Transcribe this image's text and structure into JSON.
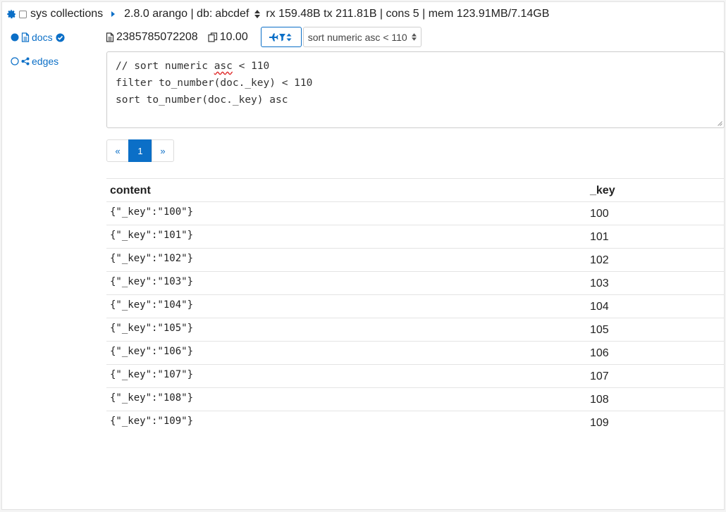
{
  "header": {
    "collections_label": "sys collections",
    "version_db_label": "2.8.0 arango | db:",
    "db_name": "abcdef",
    "stats": "rx 159.48B tx 211.81B | cons 5 | mem 123.91MB/7.14GB"
  },
  "sidebar": {
    "items": [
      {
        "label": "docs",
        "selected": true
      },
      {
        "label": "edges",
        "selected": false
      }
    ]
  },
  "toolbar": {
    "doc_count": "2385785072208",
    "size_value": "10.00",
    "query_select_value": "sort numeric asc < 110"
  },
  "query": {
    "line1_before": "// sort numeric ",
    "line1_flagged": "asc",
    "line1_after": " < 110",
    "line2": "filter to_number(doc._key) < 110",
    "line3": "sort to_number(doc._key) asc"
  },
  "pagination": {
    "prev": "«",
    "current": "1",
    "next": "»"
  },
  "table": {
    "headers": [
      "content",
      "_key"
    ],
    "rows": [
      [
        "{\"_key\":\"100\"}",
        "100"
      ],
      [
        "{\"_key\":\"101\"}",
        "101"
      ],
      [
        "{\"_key\":\"102\"}",
        "102"
      ],
      [
        "{\"_key\":\"103\"}",
        "103"
      ],
      [
        "{\"_key\":\"104\"}",
        "104"
      ],
      [
        "{\"_key\":\"105\"}",
        "105"
      ],
      [
        "{\"_key\":\"106\"}",
        "106"
      ],
      [
        "{\"_key\":\"107\"}",
        "107"
      ],
      [
        "{\"_key\":\"108\"}",
        "108"
      ],
      [
        "{\"_key\":\"109\"}",
        "109"
      ]
    ]
  },
  "colors": {
    "accent": "#0b6fc7",
    "border": "#dcdcdc",
    "squiggle": "#e03030"
  },
  "icons": {
    "gear": "gear-icon",
    "caret": "caret-right-icon",
    "radio_filled": "radio-filled-icon",
    "radio_empty": "radio-empty-icon",
    "document": "document-icon",
    "check_circle": "check-circle-icon",
    "share": "share-icon",
    "copy": "copy-icon",
    "filter": "plane-filter-sort-icon",
    "select_arrows": "select-arrows-icon",
    "resize": "resize-handle-icon"
  }
}
